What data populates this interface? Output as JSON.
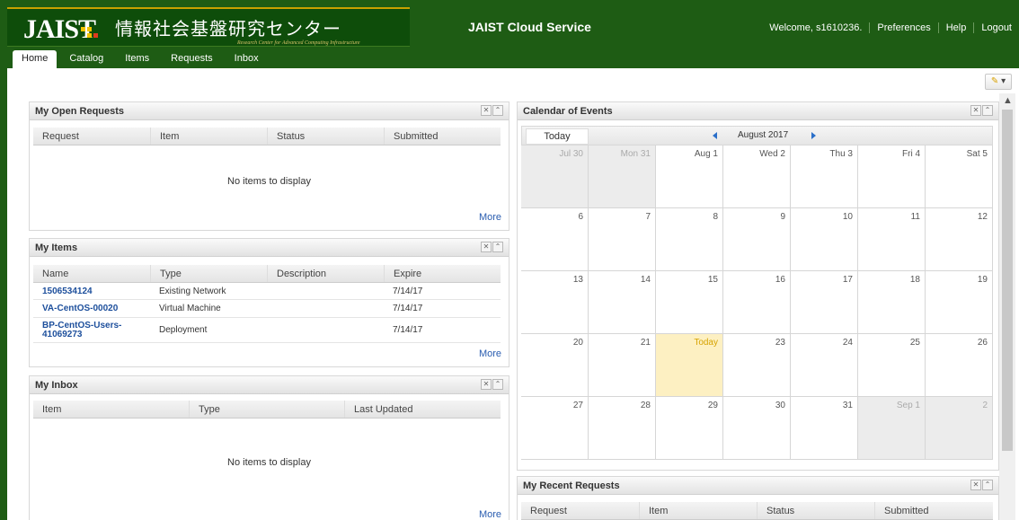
{
  "header": {
    "logo_text": "JAIST",
    "logo_jp": "情報社会基盤研究センター",
    "logo_en": "Research Center for Advanced Computing Infrastructure",
    "app_title": "JAIST Cloud Service",
    "welcome": "Welcome, s1610236.",
    "links": [
      "Preferences",
      "Help",
      "Logout"
    ]
  },
  "tabs": [
    "Home",
    "Catalog",
    "Items",
    "Requests",
    "Inbox"
  ],
  "colors": {
    "header_bg": "#1e5c14",
    "link": "#1d4f9c",
    "today": "#fdf0c2"
  },
  "open_requests": {
    "title": "My Open Requests",
    "columns": [
      "Request",
      "Item",
      "Status",
      "Submitted"
    ],
    "empty": "No items to display",
    "more": "More"
  },
  "my_items": {
    "title": "My Items",
    "columns": [
      "Name",
      "Type",
      "Description",
      "Expire"
    ],
    "rows": [
      {
        "name": "1506534124",
        "type": "Existing Network",
        "description": "",
        "expire": "7/14/17"
      },
      {
        "name": "VA-CentOS-00020",
        "type": "Virtual Machine",
        "description": "",
        "expire": "7/14/17"
      },
      {
        "name": "BP-CentOS-Users-41069273",
        "type": "Deployment",
        "description": "",
        "expire": "7/14/17"
      }
    ],
    "more": "More"
  },
  "inbox": {
    "title": "My Inbox",
    "columns": [
      "Item",
      "Type",
      "Last Updated"
    ],
    "empty": "No items to display",
    "more": "More"
  },
  "calendar": {
    "title": "Calendar of Events",
    "today_button": "Today",
    "month": "August 2017",
    "weeks": [
      [
        "Jul 30",
        "Mon 31",
        "Aug 1",
        "Wed 2",
        "Thu 3",
        "Fri 4",
        "Sat 5"
      ],
      [
        "6",
        "7",
        "8",
        "9",
        "10",
        "11",
        "12"
      ],
      [
        "13",
        "14",
        "15",
        "16",
        "17",
        "18",
        "19"
      ],
      [
        "20",
        "21",
        "Today",
        "23",
        "24",
        "25",
        "26"
      ],
      [
        "27",
        "28",
        "29",
        "30",
        "31",
        "Sep 1",
        "2"
      ]
    ]
  },
  "recent_requests": {
    "title": "My Recent Requests",
    "columns": [
      "Request",
      "Item",
      "Status",
      "Submitted"
    ]
  }
}
